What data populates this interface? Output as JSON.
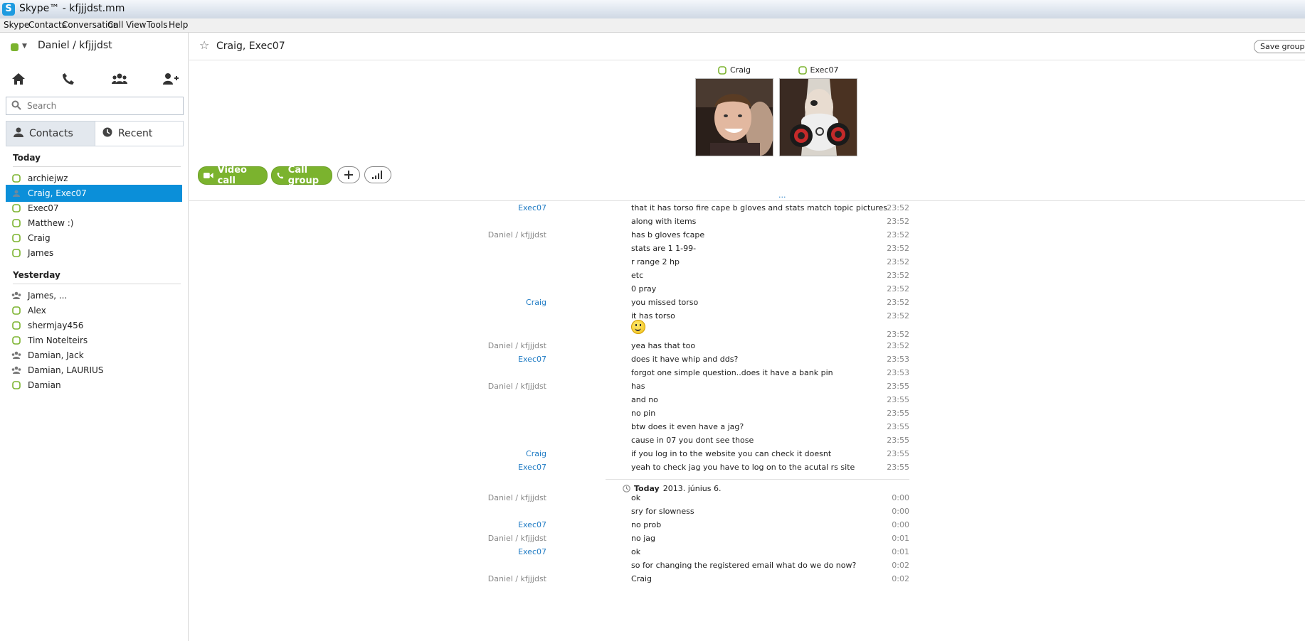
{
  "window": {
    "title": "Skype™ - kfjjjdst.mm",
    "app_icon": "S"
  },
  "menu": [
    "Skype",
    "Contacts",
    "Conversation",
    "Call",
    "View",
    "Tools",
    "Help"
  ],
  "sidebar": {
    "user": "Daniel / kfjjjdst",
    "search_placeholder": "Search",
    "tabs": {
      "contacts": "Contacts",
      "recent": "Recent"
    },
    "groups": [
      {
        "label": "Today",
        "items": [
          "archiejwz",
          "Craig, Exec07",
          "Exec07",
          "Matthew :)",
          "Craig",
          "James"
        ]
      },
      {
        "label": "Yesterday",
        "items": [
          "James, ...",
          "Alex",
          "shermjay456",
          "Tim Notelteirs",
          "Damian, Jack",
          "Damian, LAURIUS",
          "Damian"
        ]
      }
    ],
    "selected_item": "Craig, Exec07"
  },
  "conversation": {
    "title": "Craig, Exec07",
    "save_group": "Save group in",
    "participants": [
      "Craig",
      "Exec07"
    ],
    "buttons": {
      "video_call": "Video call",
      "call_group": "Call group"
    },
    "more": "...",
    "messages": [
      {
        "sender": "Exec07",
        "text": "that it has torso fire cape b gloves and stats match topic pictures",
        "time": "23:52"
      },
      {
        "sender": "",
        "text": "along with items",
        "time": "23:52"
      },
      {
        "sender": "Daniel / kfjjjdst",
        "text": "has b gloves fcape",
        "time": "23:52"
      },
      {
        "sender": "",
        "text": "stats are 1 1-99-",
        "time": "23:52"
      },
      {
        "sender": "",
        "text": "r range  2 hp",
        "time": "23:52"
      },
      {
        "sender": "",
        "text": "etc",
        "time": "23:52"
      },
      {
        "sender": "",
        "text": "0 pray",
        "time": "23:52"
      },
      {
        "sender": "Craig",
        "text": "you missed torso",
        "time": "23:52"
      },
      {
        "sender": "",
        "text": "it has torso",
        "time": "23:52"
      },
      {
        "sender": "",
        "text": "",
        "time": "23:52",
        "emoji": "smile"
      },
      {
        "sender": "Daniel / kfjjjdst",
        "text": "yea has that too",
        "time": "23:52"
      },
      {
        "sender": "Exec07",
        "text": "does it have whip and dds?",
        "time": "23:53"
      },
      {
        "sender": "",
        "text": "forgot one simple question..does it have a bank pin",
        "time": "23:53"
      },
      {
        "sender": "Daniel / kfjjjdst",
        "text": "has",
        "time": "23:55"
      },
      {
        "sender": "",
        "text": "and no",
        "time": "23:55"
      },
      {
        "sender": "",
        "text": "no pin",
        "time": "23:55"
      },
      {
        "sender": "",
        "text": "btw does it even have a jag?",
        "time": "23:55"
      },
      {
        "sender": "",
        "text": "cause in 07 you dont see those",
        "time": "23:55"
      },
      {
        "sender": "Craig",
        "text": "if you log in to the website you can check it doesnt",
        "time": "23:55"
      },
      {
        "sender": "Exec07",
        "text": "yeah to check jag you have to log on to the acutal rs site",
        "time": "23:55"
      }
    ],
    "day_separator": {
      "bold": "Today",
      "date": "2013. június 6."
    },
    "messages_today": [
      {
        "sender": "Daniel / kfjjjdst",
        "text": "ok",
        "time": "0:00"
      },
      {
        "sender": "",
        "text": "sry for slowness",
        "time": "0:00"
      },
      {
        "sender": "Exec07",
        "text": "no prob",
        "time": "0:00"
      },
      {
        "sender": "Daniel / kfjjjdst",
        "text": "no jag",
        "time": "0:01"
      },
      {
        "sender": "Exec07",
        "text": "ok",
        "time": "0:01"
      },
      {
        "sender": "",
        "text": "so for changing the registered email what do we do now?",
        "time": "0:02"
      },
      {
        "sender": "Daniel / kfjjjdst",
        "text": "Craig",
        "time": "0:02"
      }
    ]
  },
  "colors": {
    "accent_green": "#7bb32e",
    "selection_blue": "#0b8fd9",
    "link_blue": "#1f7bc4"
  }
}
